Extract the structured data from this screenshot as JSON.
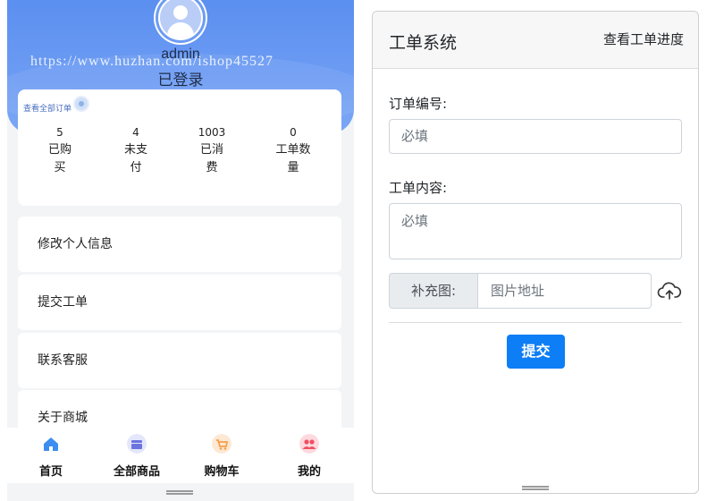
{
  "profile": {
    "username": "admin",
    "watermark": "https://www.huzhan.com/ishop45527",
    "status": "已登录"
  },
  "orders": {
    "view_all": "查看全部订单",
    "stats": [
      {
        "value": "5",
        "label": "已购买"
      },
      {
        "value": "4",
        "label": "未支付"
      },
      {
        "value": "1003",
        "label": "已消费"
      },
      {
        "value": "0",
        "label": "工单数量"
      }
    ]
  },
  "menu": [
    {
      "label": "修改个人信息"
    },
    {
      "label": "提交工单"
    },
    {
      "label": "联系客服"
    },
    {
      "label": "关于商城"
    }
  ],
  "tabbar": [
    {
      "label": "首页",
      "icon": "home-icon",
      "color": "#3d8ef0"
    },
    {
      "label": "全部商品",
      "icon": "store-icon",
      "color": "#6c74e0"
    },
    {
      "label": "购物车",
      "icon": "cart-icon",
      "color": "#f5a04a"
    },
    {
      "label": "我的",
      "icon": "user-group-icon",
      "color": "#f04f63"
    }
  ],
  "ticket": {
    "title": "工单系统",
    "progress_link": "查看工单进度",
    "order_no_label": "订单编号:",
    "order_no_placeholder": "必填",
    "content_label": "工单内容:",
    "content_placeholder": "必填",
    "image_addon": "补充图:",
    "image_placeholder": "图片地址",
    "upload_icon": "cloud-upload-icon",
    "submit_label": "提交",
    "accent": "#0d7ef5"
  }
}
